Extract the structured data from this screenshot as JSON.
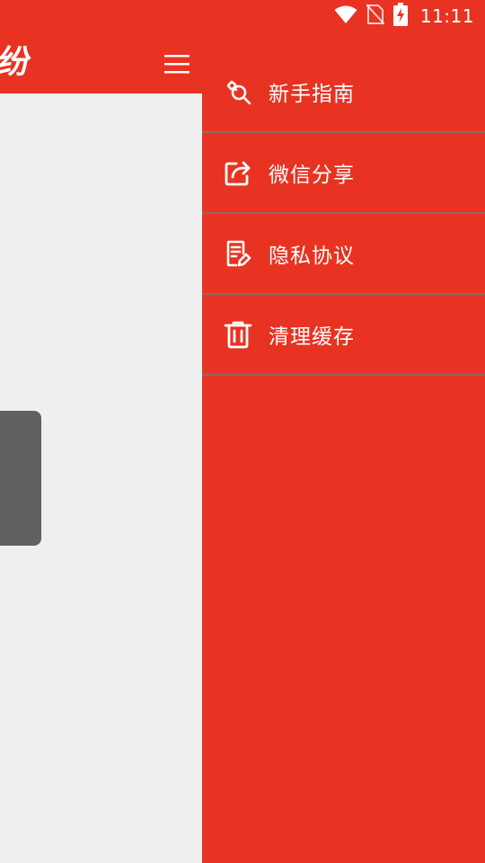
{
  "status_bar": {
    "time": "11:11",
    "icons": [
      "wifi-icon",
      "no-sim-icon",
      "battery-charging-icon"
    ]
  },
  "header": {
    "logo_text": "纷",
    "menu_icon": "hamburger-menu-icon"
  },
  "drawer": {
    "items": [
      {
        "label": "新手指南",
        "icon": "wrench-search-icon"
      },
      {
        "label": "微信分享",
        "icon": "share-icon"
      },
      {
        "label": "隐私协议",
        "icon": "document-edit-icon"
      },
      {
        "label": "清理缓存",
        "icon": "trash-icon"
      }
    ]
  },
  "colors": {
    "primary": "#E83322",
    "content_bg": "#EFEFEF",
    "floating_tab": "#616161",
    "divider": "#8A6A6A",
    "text": "#FFFFFF"
  }
}
